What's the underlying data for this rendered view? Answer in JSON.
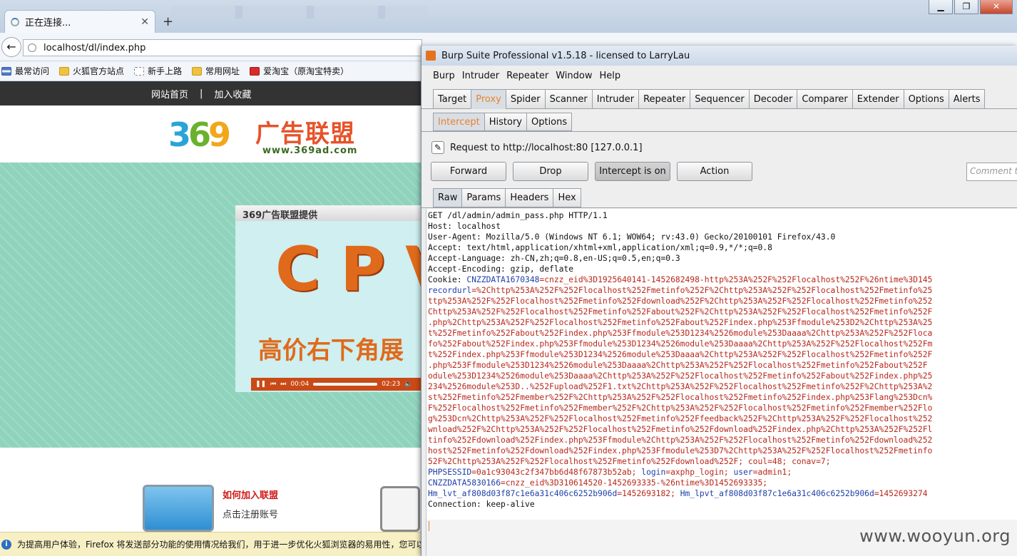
{
  "firefox": {
    "tab_title": "正在连接...",
    "url": "localhost/dl/index.php",
    "bookmarks": [
      "最常访问",
      "火狐官方站点",
      "新手上路",
      "常用网址",
      "爱淘宝（原淘宝特卖）"
    ],
    "site_nav": [
      "网站首页",
      "|",
      "加入收藏"
    ],
    "logo_digits": [
      "3",
      "6",
      "9"
    ],
    "logo_cn": "广告联盟",
    "logo_url": "www.369ad.com",
    "ad_title": "369广告联盟提供",
    "ad_main": "CPV",
    "ad_sub": "高价右下角展",
    "ad_time_now": "00:04",
    "ad_time_total": "02:23",
    "join_title": "如何加入联盟",
    "join_sub": "点击注册账号",
    "notice": "为提高用户体验，Firefox 将发送部分功能的使用情况给我们，用于进一步优化火狐浏览器的易用性，您可以"
  },
  "burp": {
    "title": "Burp Suite Professional v1.5.18 - licensed to LarryLau",
    "menu": [
      "Burp",
      "Intruder",
      "Repeater",
      "Window",
      "Help"
    ],
    "tabs": [
      "Target",
      "Proxy",
      "Spider",
      "Scanner",
      "Intruder",
      "Repeater",
      "Sequencer",
      "Decoder",
      "Comparer",
      "Extender",
      "Options",
      "Alerts"
    ],
    "active_tab": "Proxy",
    "subtabs": [
      "Intercept",
      "History",
      "Options"
    ],
    "active_subtab": "Intercept",
    "request_label": "Request to http://localhost:80  [127.0.0.1]",
    "buttons": {
      "forward": "Forward",
      "drop": "Drop",
      "intercept": "Intercept is on",
      "action": "Action"
    },
    "comment_placeholder": "Comment th",
    "view_tabs": [
      "Raw",
      "Params",
      "Headers",
      "Hex"
    ],
    "active_view_tab": "Raw",
    "request_lines": [
      "GET /dl/admin/admin_pass.php HTTP/1.1",
      "Host: localhost",
      "User-Agent: Mozilla/5.0 (Windows NT 6.1; WOW64; rv:43.0) Gecko/20100101 Firefox/43.0",
      "Accept: text/html,application/xhtml+xml,application/xml;q=0.9,*/*;q=0.8",
      "Accept-Language: zh-CN,zh;q=0.8,en-US;q=0.5,en;q=0.3",
      "Accept-Encoding: gzip, deflate"
    ],
    "cookie_label": "Cookie: ",
    "cookie_key1": "CNZZDATA1670348",
    "cookie_val1": "=cnzz_eid%3D1925640141-1452682498-http%253A%252F%252Flocalhost%252F%26ntime%3D145",
    "cookie_wrap": [
      "recordurl",
      "ttp%253A%252F%252Flocalhost%252Fmetinfo%252Fdownload%252F%2Chttp%253A%252F%252Flocalhost%252Fmetinfo%252",
      "Chttp%253A%252F%252Flocalhost%252Fmetinfo%252Fabout%252F%2Chttp%253A%252F%252Flocalhost%252Fmetinfo%252F",
      ".php%2Chttp%253A%252F%252Flocalhost%252Fmetinfo%252Fabout%252Findex.php%253Ffmodule%253D2%2Chttp%253A%25",
      "t%252Fmetinfo%252Fabout%252Findex.php%253Ffmodule%253D1234%2526module%253Daaaa%2Chttp%253A%252F%252Floca",
      "fo%252Fabout%252Findex.php%253Ffmodule%253D1234%2526module%253Daaaa%2Chttp%253A%252F%252Flocalhost%252Fm",
      "t%252Findex.php%253Ffmodule%253D1234%2526module%253Daaaa%2Chttp%253A%252F%252Flocalhost%252Fmetinfo%252F",
      ".php%253Ffmodule%253D1234%2526module%253Daaaa%2Chttp%253A%252F%252Flocalhost%252Fmetinfo%252Fabout%252F",
      "odule%253D1234%2526module%253Daaaa%2Chttp%253A%252F%252Flocalhost%252Fmetinfo%252Fabout%252Findex.php%25",
      "234%2526module%253D..%252Fupload%252F1.txt%2Chttp%253A%252F%252Flocalhost%252Fmetinfo%252F%2Chttp%253A%2",
      "st%252Fmetinfo%252Fmember%252F%2Chttp%253A%252F%252Flocalhost%252Fmetinfo%252Findex.php%253Flang%253Dcn%",
      "F%252Flocalhost%252Fmetinfo%252Fmember%252F%2Chttp%253A%252F%252Flocalhost%252Fmetinfo%252Fmember%252Flo",
      "g%253Dcn%2Chttp%253A%252F%252Flocalhost%252Fmetinfo%252Ffeedback%252F%2Chttp%253A%252F%252Flocalhost%252",
      "wnload%252F%2Chttp%253A%252F%252Flocalhost%252Fmetinfo%252Fdownload%252Findex.php%2Chttp%253A%252F%252Fl",
      "tinfo%252Fdownload%252Findex.php%253Ffmodule%2Chttp%253A%252F%252Flocalhost%252Fmetinfo%252Fdownload%252",
      "host%252Fmetinfo%252Fdownload%252Findex.php%253Ffmodule%253D7%2Chttp%253A%252F%252Flocalhost%252Fmetinfo",
      "52F%2Chttp%253A%252F%252Flocalhost%252Fmetinfo%252Fdownload%252F; coul=48; conav=7;"
    ],
    "recordurl_val": "=%2Chttp%253A%252F%252Flocalhost%252Fmetinfo%252F%2Chttp%253A%252F%252Flocalhost%252Fmetinfo%25",
    "line_sess": [
      "PHPSESSID",
      "=0a1c93043c2f347bb6d48f67873b52ab; ",
      "login",
      "=axphp_login; ",
      "user",
      "=admin1;"
    ],
    "line_cnzz2": [
      "CNZZDATA5830166",
      "=cnzz_eid%3D310614520-1452693335-%26ntime%3D1452693335;"
    ],
    "line_hm": [
      "Hm_lvt_af808d03f87c1e6a31c406c6252b906d",
      "=1452693182; ",
      "Hm_lpvt_af808d03f87c1e6a31c406c6252b906d",
      "=1452693274"
    ],
    "line_conn": "Connection: keep-alive",
    "watermark": "www.wooyun.org"
  }
}
